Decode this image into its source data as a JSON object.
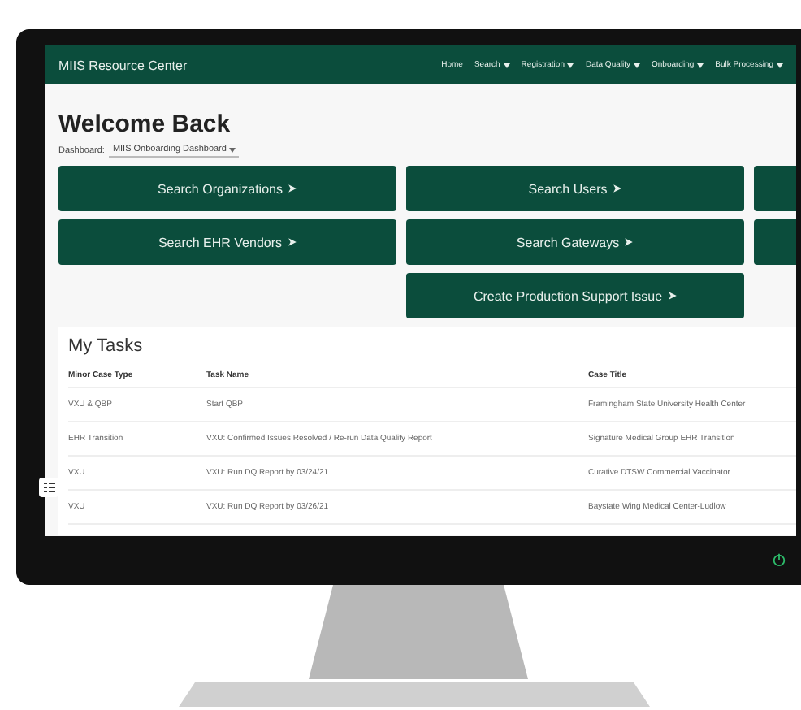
{
  "app": {
    "title": "MIIS Resource Center"
  },
  "nav": [
    {
      "label": "Home",
      "has_menu": false
    },
    {
      "label": "Search",
      "has_menu": true
    },
    {
      "label": "Registration",
      "has_menu": true
    },
    {
      "label": "Data Quality",
      "has_menu": true
    },
    {
      "label": "Onboarding",
      "has_menu": true
    },
    {
      "label": "Bulk Processing",
      "has_menu": true
    }
  ],
  "heading": "Welcome Back",
  "dashboard": {
    "label": "Dashboard:",
    "value": "MIIS Onboarding Dashboard"
  },
  "actions": [
    {
      "kind": "button",
      "label": "Search Organizations"
    },
    {
      "kind": "button",
      "label": "Search Users"
    },
    {
      "kind": "cut"
    },
    {
      "kind": "button",
      "label": "Search EHR Vendors"
    },
    {
      "kind": "button",
      "label": "Search Gateways"
    },
    {
      "kind": "cut"
    },
    {
      "kind": "gap"
    },
    {
      "kind": "button",
      "label": "Create Production Support Issue"
    },
    {
      "kind": "gap"
    }
  ],
  "tasks": {
    "title": "My Tasks",
    "columns": [
      "Minor Case Type",
      "Task Name",
      "Case Title"
    ],
    "rows": [
      [
        "VXU & QBP",
        "Start QBP",
        "Framingham State University Health Center"
      ],
      [
        "EHR Transition",
        "VXU: Confirmed Issues Resolved / Re-run Data Quality Report",
        "Signature Medical Group EHR Transition"
      ],
      [
        "VXU",
        "VXU: Run DQ Report by 03/24/21",
        "Curative DTSW Commercial Vaccinator"
      ],
      [
        "VXU",
        "VXU: Run DQ Report by 03/26/21",
        "Baystate Wing Medical Center-Ludlow"
      ]
    ]
  }
}
